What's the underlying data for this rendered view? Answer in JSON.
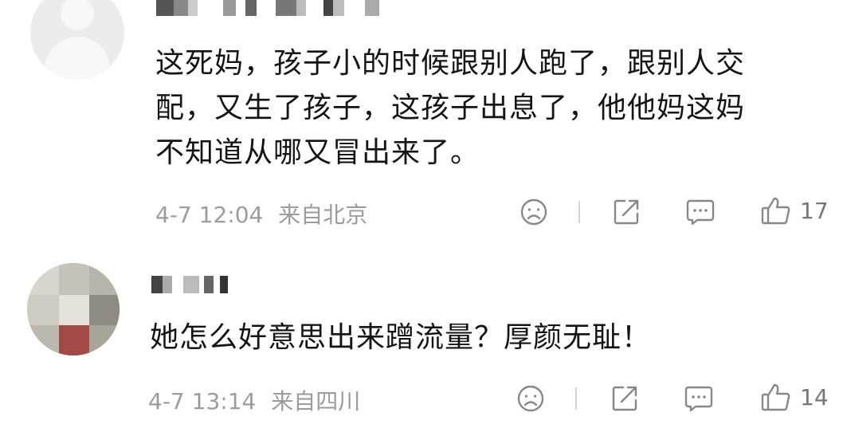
{
  "comments": [
    {
      "author": "",
      "text_lines": [
        "这死妈，孩子小的时候跟别人跑了，跟别人交",
        "配，又生了孩子，这孩子出息了，他他妈这妈",
        "不知道从哪又冒出来了。"
      ],
      "date_time": "4-7 12:04",
      "location": "来自北京",
      "like_count": "17"
    },
    {
      "author": "",
      "text_lines": [
        "她怎么好意思出来蹭流量？厚颜无耻！"
      ],
      "date_time": "4-7 13:14",
      "location": "来自四川",
      "like_count": "14"
    }
  ],
  "icons": {
    "dislike": "sad-face-icon",
    "share": "share-icon",
    "reply": "comment-icon",
    "like": "thumbs-up-icon"
  },
  "colors": {
    "text": "#141414",
    "meta": "#9c9c9c",
    "icon": "#888888"
  }
}
